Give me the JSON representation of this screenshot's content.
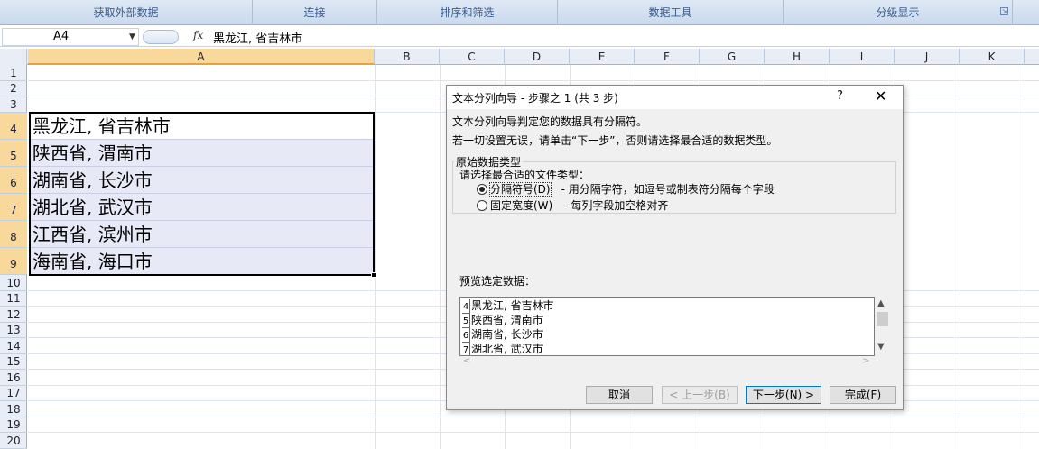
{
  "ribbon": {
    "groups": [
      "获取外部数据",
      "连接",
      "排序和筛选",
      "数据工具",
      "分级显示"
    ],
    "launcher_icon": "dialog-launcher-icon"
  },
  "formula_bar": {
    "name_box": "A4",
    "fx": "fx",
    "content": "黑龙江, 省吉林市"
  },
  "grid": {
    "columns": [
      "A",
      "B",
      "C",
      "D",
      "E",
      "F",
      "G",
      "H",
      "I",
      "J",
      "K"
    ],
    "selected_column": "A",
    "rows": [
      "1",
      "2",
      "3",
      "4",
      "5",
      "6",
      "7",
      "8",
      "9",
      "10",
      "11",
      "12",
      "13",
      "14",
      "15",
      "16",
      "17",
      "18",
      "19",
      "20"
    ],
    "selected_rows": [
      "4",
      "5",
      "6",
      "7",
      "8",
      "9"
    ],
    "cells_a": [
      {
        "row": "4",
        "text": "黑龙江, 省吉林市"
      },
      {
        "row": "5",
        "text": "陕西省, 渭南市"
      },
      {
        "row": "6",
        "text": "湖南省, 长沙市"
      },
      {
        "row": "7",
        "text": "湖北省, 武汉市"
      },
      {
        "row": "8",
        "text": "江西省, 滨州市"
      },
      {
        "row": "9",
        "text": "海南省, 海口市"
      }
    ]
  },
  "dialog": {
    "title": "文本分列向导 - 步骤之 1 (共 3 步)",
    "help": "?",
    "close": "✕",
    "line1": "文本分列向导判定您的数据具有分隔符。",
    "line2": "若一切设置无误，请单击“下一步”，否则请选择最合适的数据类型。",
    "group_title": "原始数据类型",
    "prompt": "请选择最合适的文件类型：",
    "options": [
      {
        "label": "分隔符号(D)",
        "desc": "- 用分隔字符，如逗号或制表符分隔每个字段",
        "selected": true
      },
      {
        "label": "固定宽度(W)",
        "desc": "- 每列字段加空格对齐",
        "selected": false
      }
    ],
    "preview_label": "预览选定数据：",
    "preview_rows": [
      {
        "num": "4",
        "text": "黑龙江, 省吉林市"
      },
      {
        "num": "5",
        "text": "陕西省, 渭南市"
      },
      {
        "num": "6",
        "text": "湖南省, 长沙市"
      },
      {
        "num": "7",
        "text": "湖北省, 武汉市"
      }
    ],
    "buttons": {
      "cancel": "取消",
      "back": "< 上一步(B)",
      "next": "下一步(N) >",
      "finish": "完成(F)"
    }
  }
}
